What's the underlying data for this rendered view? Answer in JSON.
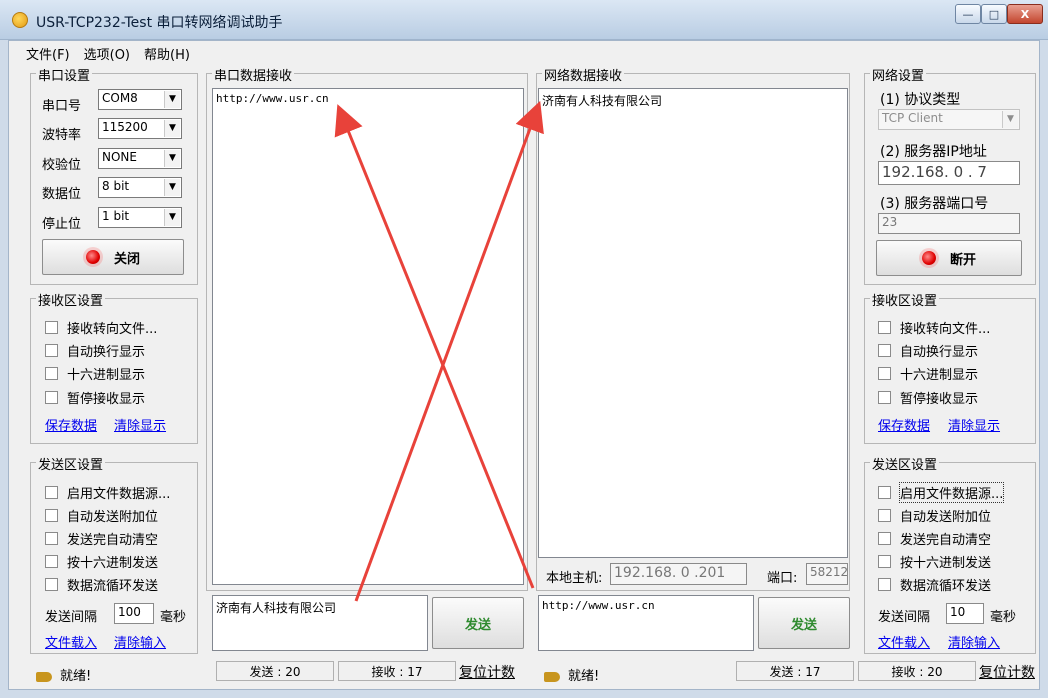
{
  "window": {
    "title": "USR-TCP232-Test 串口转网络调试助手",
    "minimize_glyph": "—",
    "maximize_glyph": "□",
    "close_glyph": "X"
  },
  "menu": [
    "文件(F)",
    "选项(O)",
    "帮助(H)"
  ],
  "serial": {
    "group_title": "串口设置",
    "port_label": "串口号",
    "port_value": "COM8",
    "baud_label": "波特率",
    "baud_value": "115200",
    "parity_label": "校验位",
    "parity_value": "NONE",
    "databits_label": "数据位",
    "databits_value": "8 bit",
    "stopbits_label": "停止位",
    "stopbits_value": "1 bit",
    "close_button": "关闭"
  },
  "left_recv": {
    "group_title": "接收区设置",
    "options": [
      "接收转向文件...",
      "自动换行显示",
      "十六进制显示",
      "暂停接收显示"
    ],
    "save_link": "保存数据",
    "clear_link": "清除显示"
  },
  "left_send": {
    "group_title": "发送区设置",
    "options": [
      "启用文件数据源...",
      "自动发送附加位",
      "发送完自动清空",
      "按十六进制发送",
      "数据流循环发送"
    ],
    "interval_label": "发送间隔",
    "interval_value": "100",
    "interval_unit": "毫秒",
    "load_link": "文件载入",
    "clear_link": "清除输入"
  },
  "serial_recv": {
    "group_title": "串口数据接收",
    "content": "http://www.usr.cn"
  },
  "net_recv": {
    "group_title": "网络数据接收",
    "content": "济南有人科技有限公司"
  },
  "net_bottom": {
    "local_host_label": "本地主机:",
    "local_host_value": "192.168. 0 .201",
    "port_label": "端口:",
    "port_value": "58212"
  },
  "serial_send": {
    "input": "济南有人科技有限公司",
    "button": "发送"
  },
  "net_send": {
    "input": "http://www.usr.cn",
    "button": "发送"
  },
  "network": {
    "group_title": "网络设置",
    "protocol_label": "(1) 协议类型",
    "protocol_value": "TCP Client",
    "server_ip_label": "(2) 服务器IP地址",
    "server_ip_value": "192.168. 0 . 7",
    "server_port_label": "(3) 服务器端口号",
    "server_port_value": "23",
    "disconnect_button": "断开"
  },
  "right_recv": {
    "group_title": "接收区设置",
    "options": [
      "接收转向文件...",
      "自动换行显示",
      "十六进制显示",
      "暂停接收显示"
    ],
    "save_link": "保存数据",
    "clear_link": "清除显示"
  },
  "right_send": {
    "group_title": "发送区设置",
    "options": [
      "启用文件数据源...",
      "自动发送附加位",
      "发送完自动清空",
      "按十六进制发送",
      "数据流循环发送"
    ],
    "interval_label": "发送间隔",
    "interval_value": "10",
    "interval_unit": "毫秒",
    "load_link": "文件载入",
    "clear_link": "清除输入"
  },
  "status_left": {
    "ready": "就绪!",
    "sent": "发送 : 20",
    "received": "接收 : 17",
    "reset": "复位计数"
  },
  "status_right": {
    "ready": "就绪!",
    "sent": "发送 : 17",
    "received": "接收 : 20",
    "reset": "复位计数"
  },
  "colors": {
    "annotation_arrow": "#e8423a",
    "led": "#e00000",
    "link": "#0000ee"
  }
}
